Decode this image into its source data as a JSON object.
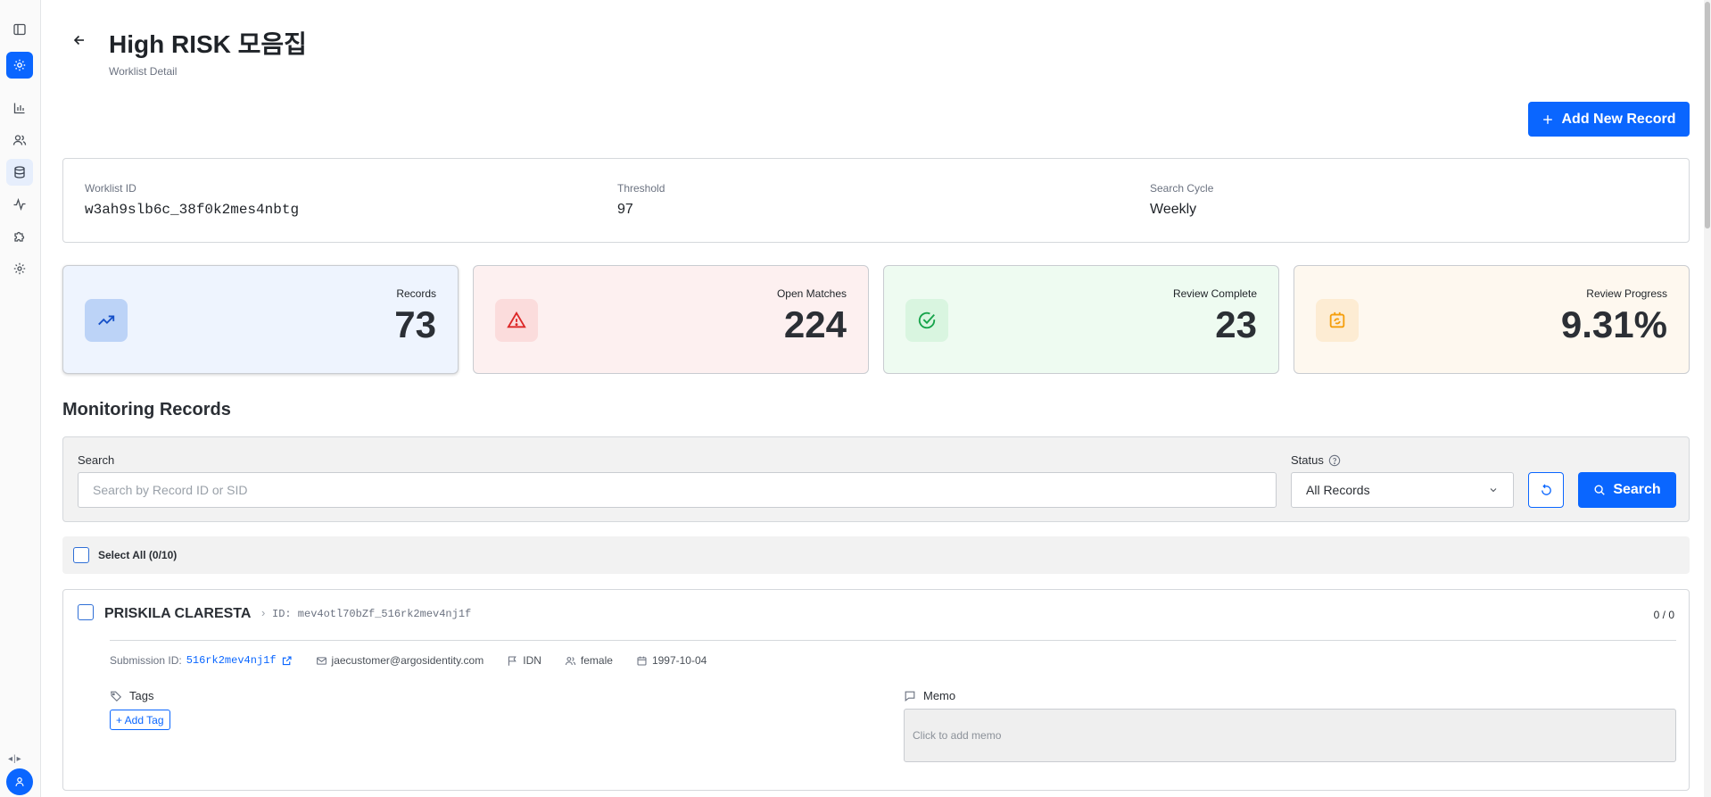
{
  "sidebar": {
    "items": [
      {
        "name": "panel-toggle-icon"
      },
      {
        "name": "settings-icon",
        "active": true
      },
      {
        "name": "chart-icon"
      },
      {
        "name": "users-icon"
      },
      {
        "name": "database-icon"
      },
      {
        "name": "activity-icon"
      },
      {
        "name": "puzzle-icon"
      },
      {
        "name": "gear-icon"
      }
    ],
    "resize_handle": "◂|▸"
  },
  "header": {
    "title": "High RISK 모음집",
    "subtitle": "Worklist Detail",
    "add_button_label": "Add New Record"
  },
  "info": {
    "worklist_id_label": "Worklist ID",
    "worklist_id": "w3ah9slb6c_38f0k2mes4nbtg",
    "threshold_label": "Threshold",
    "threshold": "97",
    "search_cycle_label": "Search Cycle",
    "search_cycle": "Weekly"
  },
  "stats": [
    {
      "label": "Records",
      "value": "73",
      "bg": "#eef4fe",
      "icon_bg": "#bcd3f7",
      "icon_color": "#1650c8"
    },
    {
      "label": "Open Matches",
      "value": "224",
      "bg": "#fdf0f0",
      "icon_bg": "#fbdcdc",
      "icon_color": "#dc2626"
    },
    {
      "label": "Review Complete",
      "value": "23",
      "bg": "#eefbf1",
      "icon_bg": "#d9f5e0",
      "icon_color": "#16a34a"
    },
    {
      "label": "Review Progress",
      "value": "9.31%",
      "bg": "#fef8ef",
      "icon_bg": "#fdecd3",
      "icon_color": "#f59e0b"
    }
  ],
  "monitoring": {
    "section_title": "Monitoring Records",
    "search_label": "Search",
    "search_placeholder": "Search by Record ID or SID",
    "status_label": "Status",
    "status_value": "All Records",
    "search_button_label": "Search",
    "select_all_label": "Select All (0/10)"
  },
  "records": [
    {
      "name": "PRISKILA CLARESTA",
      "id": "ID: mev4otl70bZf_516rk2mev4nj1f",
      "count": "0 / 0",
      "submission_label": "Submission ID:",
      "submission_id": "516rk2mev4nj1f",
      "email": "jaecustomer@argosidentity.com",
      "country": "IDN",
      "gender": "female",
      "birthdate": "1997-10-04",
      "tags_label": "Tags",
      "add_tag_label": "+ Add Tag",
      "memo_label": "Memo",
      "memo_placeholder": "Click to add memo"
    }
  ],
  "colors": {
    "accent": "#0a66ff"
  }
}
